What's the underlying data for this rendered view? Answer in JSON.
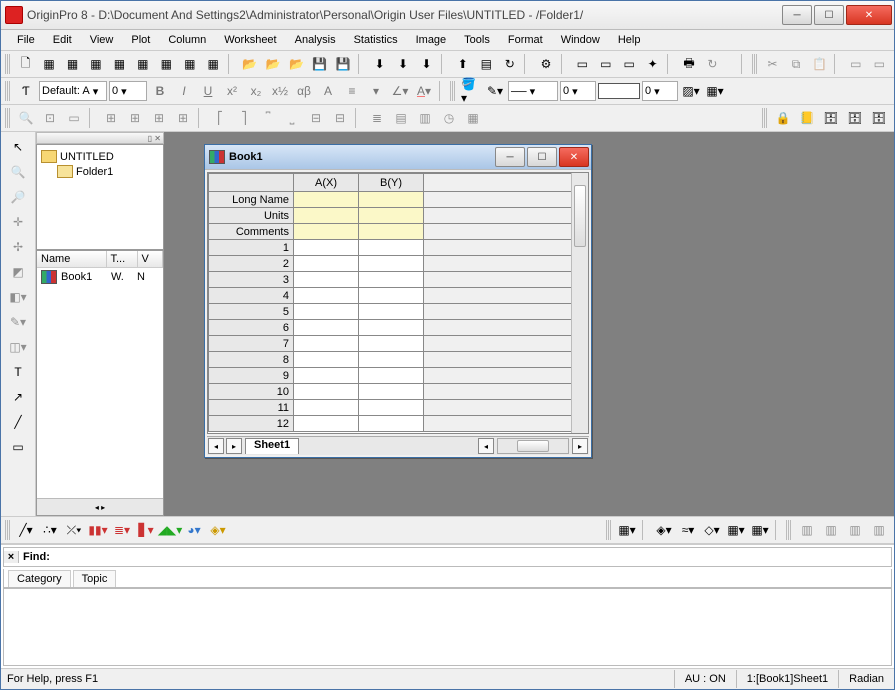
{
  "title": "OriginPro 8 - D:\\Document And Settings2\\Administrator\\Personal\\Origin User Files\\UNTITLED - /Folder1/",
  "menus": [
    "File",
    "Edit",
    "View",
    "Plot",
    "Column",
    "Worksheet",
    "Analysis",
    "Statistics",
    "Image",
    "Tools",
    "Format",
    "Window",
    "Help"
  ],
  "font_combo": "Default: A",
  "size_combo": "0",
  "stroke_combo": "0",
  "fill_combo": "0",
  "tree": {
    "root": "UNTITLED",
    "child": "Folder1"
  },
  "list": {
    "cols": [
      "Name",
      "T...",
      "V"
    ],
    "rows": [
      {
        "name": "Book1",
        "t": "W.",
        "v": "N"
      }
    ]
  },
  "book": {
    "title": "Book1",
    "cols": [
      "A(X)",
      "B(Y)"
    ],
    "meta_rows": [
      "Long Name",
      "Units",
      "Comments"
    ],
    "data_rows": 12,
    "sheet": "Sheet1"
  },
  "find": {
    "label": "Find:",
    "tabs": [
      "Category",
      "Topic"
    ],
    "value": ""
  },
  "status": {
    "help": "For Help, press F1",
    "au": "AU : ON",
    "loc": "1:[Book1]Sheet1",
    "ang": "Radian"
  }
}
